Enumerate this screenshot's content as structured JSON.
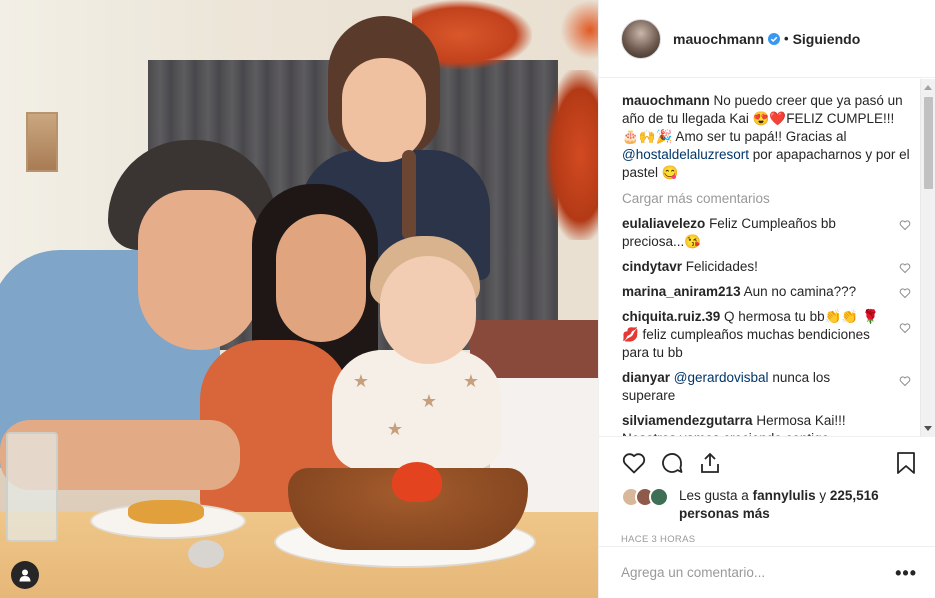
{
  "header": {
    "username": "mauochmann",
    "separator": "•",
    "follow_status": "Siguiendo"
  },
  "caption": {
    "username": "mauochmann",
    "text_part1": "No puedo creer que ya pasó un año de tu llegada Kai 😍❤️FELIZ CUMPLE!!! 🎂🙌🎉 Amo ser tu papá!! Gracias al ",
    "mention": "@hostaldelaluzresort",
    "text_part2": " por apapacharnos y por el pastel 😋"
  },
  "load_more": "Cargar más comentarios",
  "comments": [
    {
      "username": "eulaliavelezo",
      "text": "Feliz Cumpleaños bb preciosa...😘"
    },
    {
      "username": "cindytavr",
      "text": "Felicidades!"
    },
    {
      "username": "marina_aniram213",
      "text": "Aun no camina???"
    },
    {
      "username": "chiquita.ruiz.39",
      "text": "Q hermosa tu bb👏👏 🌹💋 feliz cumpleaños muchas bendiciones para tu bb"
    },
    {
      "username": "dianyar",
      "mention": "@gerardovisbal",
      "text": " nunca los superare"
    },
    {
      "username": "silviamendezgutarra",
      "text": "Hermosa Kai!!! Nosotros vamos creciendo contigo..."
    }
  ],
  "likes": {
    "prefix": "Les gusta a",
    "user": "fannylulis",
    "joiner": "y",
    "count": "225,516 personas más"
  },
  "timestamp": "HACE 3 HORAS",
  "add_comment_placeholder": "Agrega un comentario...",
  "more_options": "•••",
  "colors": {
    "link": "#003569",
    "verified": "#3897f0",
    "muted": "#999999",
    "text": "#262626"
  },
  "icons": {
    "verified": "verified-badge-icon",
    "heart": "heart-icon",
    "comment": "comment-icon",
    "share": "share-icon",
    "save": "bookmark-icon",
    "user_tag": "user-tag-icon"
  }
}
